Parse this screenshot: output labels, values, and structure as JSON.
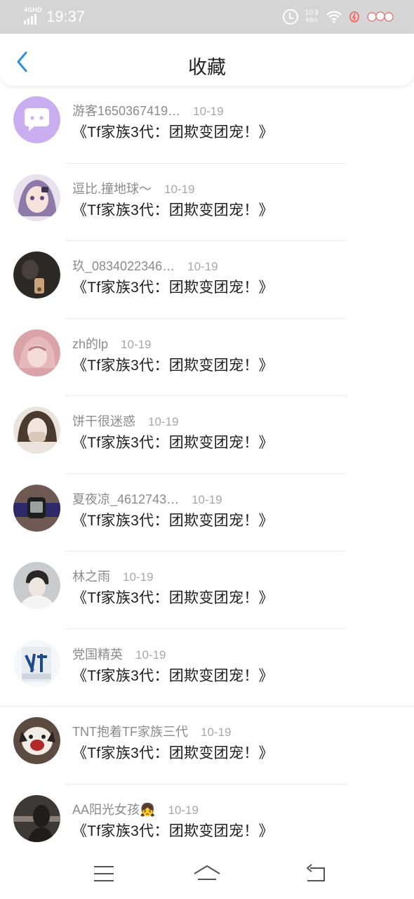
{
  "status_bar": {
    "network": "4GHD",
    "time": "19:37",
    "speed_value": "10.9",
    "speed_unit": "KB/s",
    "icons": [
      "signal-icon",
      "alarm-icon",
      "wifi-icon",
      "battery-saver-icon",
      "decorative-sticker-icon"
    ]
  },
  "header": {
    "title": "收藏",
    "back_icon": "chevron-left-icon",
    "accent": "#2f8fe0"
  },
  "favorites": [
    {
      "username": "游客1650367419…",
      "date": "10-19",
      "title": "《Tf家族3代：团欺变团宠！》",
      "avatar": "chat-bubble-avatar",
      "avatar_color": "#c9aef0"
    },
    {
      "username": "逗比.撞地球～",
      "date": "10-19",
      "title": "《Tf家族3代：团欺变团宠！》",
      "avatar": "anime-girl-avatar",
      "avatar_color": "#b7a6c9"
    },
    {
      "username": "玖_0834022346…",
      "date": "10-19",
      "title": "《Tf家族3代：团欺变团宠！》",
      "avatar": "photo-avatar",
      "avatar_color": "#3a3330"
    },
    {
      "username": "zh的lp",
      "date": "10-19",
      "title": "《Tf家族3代：团欺变团宠！》",
      "avatar": "anime-avatar",
      "avatar_color": "#d9a3a8"
    },
    {
      "username": "饼干很迷惑",
      "date": "10-19",
      "title": "《Tf家族3代：团欺变团宠！》",
      "avatar": "photo-avatar",
      "avatar_color": "#d8cbbd"
    },
    {
      "username": "夏夜凉_4612743…",
      "date": "10-19",
      "title": "《Tf家族3代：团欺变团宠！》",
      "avatar": "watch-photo-avatar",
      "avatar_color": "#5a4a44"
    },
    {
      "username": "林之雨",
      "date": "10-19",
      "title": "《Tf家族3代：团欺变团宠！》",
      "avatar": "photo-avatar",
      "avatar_color": "#9a9c9e"
    },
    {
      "username": "党国精英",
      "date": "10-19",
      "title": "《Tf家族3代：团欺变团宠！》",
      "avatar": "cup-avatar",
      "avatar_color": "#dfe6ee"
    },
    {
      "username": "TNT抱着TF家族三代",
      "date": "10-19",
      "title": "《Tf家族3代：团欺变团宠！》",
      "avatar": "dog-photo-avatar",
      "avatar_color": "#6b5a4c"
    },
    {
      "username": "AA阳光女孩👧",
      "date": "10-19",
      "title": "《Tf家族3代：团欺变团宠！》",
      "avatar": "dark-photo-avatar",
      "avatar_color": "#3d3937"
    }
  ],
  "bottom_nav": {
    "items": [
      "menu-icon",
      "home-icon",
      "back-arrow-icon"
    ]
  }
}
